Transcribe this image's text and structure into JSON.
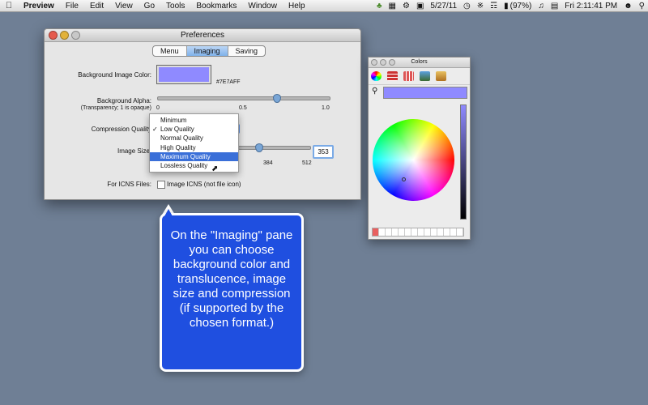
{
  "menubar": {
    "app": "Preview",
    "items": [
      "File",
      "Edit",
      "View",
      "Go",
      "Tools",
      "Bookmarks",
      "Window",
      "Help"
    ],
    "date": "5/27/11",
    "battery": "(97%)",
    "clock": "Fri 2:11:41 PM"
  },
  "prefs": {
    "title": "Preferences",
    "tabs": [
      "Menu",
      "Imaging",
      "Saving"
    ],
    "active_tab": "Imaging",
    "bg_color_label": "Background Image Color:",
    "bg_color_value": "#7E7AFF",
    "alpha_label": "Background Alpha:",
    "alpha_sub": "(Transparency; 1 is opaque)",
    "alpha_ticks": [
      "0",
      "0.5",
      "1.0"
    ],
    "alpha_value": 0.7,
    "compression_label": "Compression Quality",
    "image_size_label": "Image Size",
    "size_ticks": [
      "384",
      "512"
    ],
    "size_value": "353",
    "icns_label": "For ICNS Files:",
    "icns_checkbox": "Image ICNS (not file icon)"
  },
  "dropdown": {
    "options": [
      "Minimum",
      "Low Quality",
      "Normal Quality",
      "High Quality",
      "Maximum Quality",
      "Lossless Quality"
    ],
    "checked": "Low Quality",
    "highlighted": "Maximum Quality"
  },
  "colors_panel": {
    "title": "Colors",
    "current_color": "#8f8aff"
  },
  "callout": {
    "text": "On the \"Imaging\" pane you can choose background color and translucence, image size and compression (if supported by the chosen format.)"
  }
}
